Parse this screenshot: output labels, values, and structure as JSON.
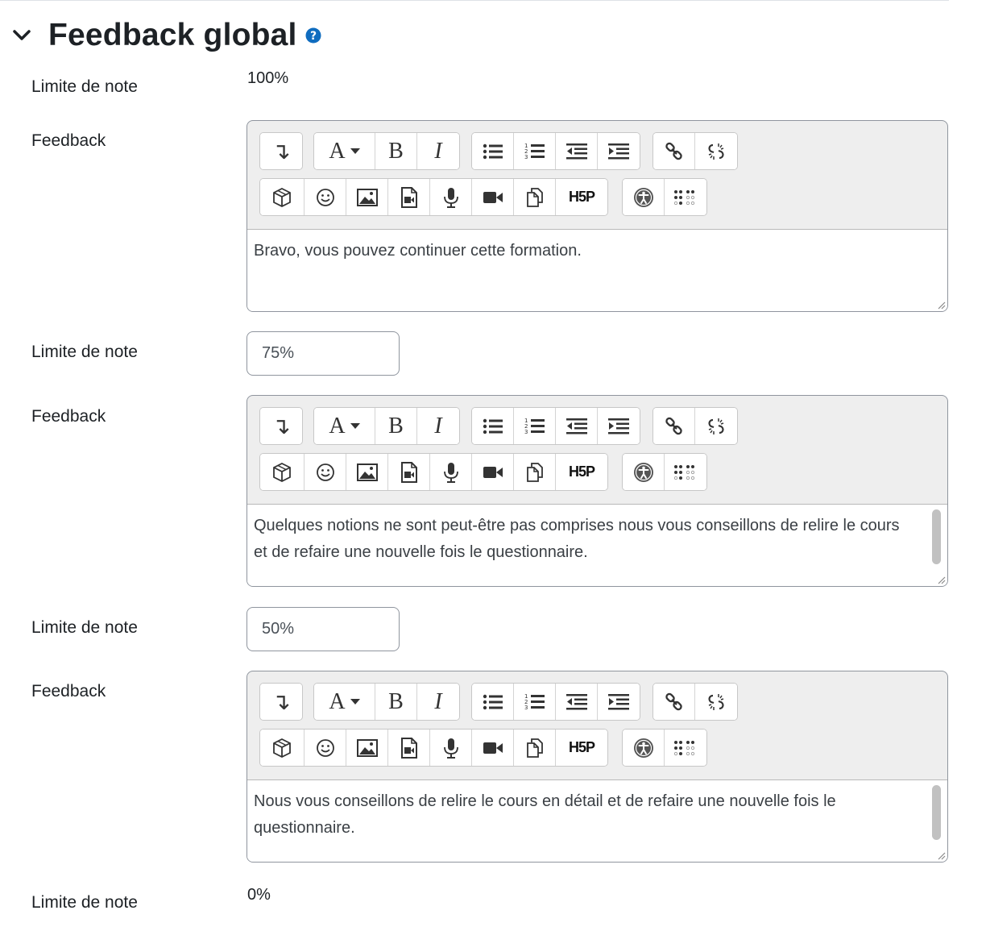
{
  "section": {
    "title": "Feedback global"
  },
  "rows": {
    "grade_label": "Limite de note",
    "feedback_label": "Feedback",
    "boundary_top": "100%",
    "boundary_bottom": "0%"
  },
  "feedback_1": {
    "text": "Bravo, vous pouvez continuer cette formation."
  },
  "grade_2": {
    "value": "75%"
  },
  "feedback_2": {
    "text": "Quelques notions ne sont peut-être pas comprises nous vous conseillons de relire le cours et de refaire une nouvelle fois le questionnaire."
  },
  "grade_3": {
    "value": "50%"
  },
  "feedback_3": {
    "text": "Nous vous conseillons de relire le cours en détail et de refaire une nouvelle fois le questionnaire."
  },
  "toolbar": {
    "collapse": "↴",
    "font": "A",
    "bold": "B",
    "italic": "I",
    "h5p": "H5P"
  },
  "icons": {
    "chevron": "chevron-down-icon",
    "help": "question-circle-icon",
    "colors": {
      "help": "#0f6cbf",
      "accessibility": "#555555"
    }
  }
}
